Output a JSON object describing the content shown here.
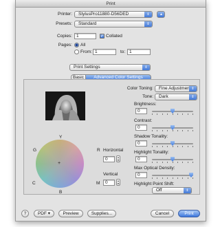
{
  "window": {
    "title": "Print"
  },
  "printer": {
    "label": "Printer:",
    "value": "StylusPro11880-D56DED"
  },
  "presets": {
    "label": "Presets:",
    "value": "Standard"
  },
  "copies": {
    "label": "Copies:",
    "value": "1",
    "collated_label": "Collated"
  },
  "pages": {
    "label": "Pages:",
    "all_label": "All",
    "from_label": "From:",
    "from_value": "1",
    "to_label": "to:",
    "to_value": "1"
  },
  "section": {
    "value": "Print Settings"
  },
  "tabs": [
    {
      "label": "Basic"
    },
    {
      "label": "Advanced Color Settings"
    }
  ],
  "color_toning": {
    "label": "Color Toning:",
    "value": "Fine Adjustment"
  },
  "tone": {
    "label": "Tone:",
    "value": "Dark"
  },
  "brightness": {
    "label": "Brightness:",
    "value": "0",
    "level": 0.5
  },
  "contrast": {
    "label": "Contrast:",
    "value": "0",
    "level": 0.5
  },
  "shadow_tonality": {
    "label": "Shadow Tonality:",
    "value": "0",
    "level": 0.5
  },
  "highlight_tonality": {
    "label": "Highlight Tonality:",
    "value": "0",
    "level": 0.5
  },
  "max_optical_density": {
    "label": "Max Optical Density:",
    "value": "0",
    "level": 1.0
  },
  "highlight_point_shift": {
    "label": "Highlight Point Shift:",
    "value": "Off"
  },
  "color_circle": {
    "y": "Y",
    "r": "R",
    "g": "G",
    "m": "M",
    "c": "C",
    "b": "B"
  },
  "horizontal": {
    "label": "Horizontal",
    "value": "0"
  },
  "vertical": {
    "label": "Vertical",
    "value": "0"
  },
  "footer": {
    "help": "?",
    "pdf": "PDF ▾",
    "preview": "Preview",
    "supplies": "Supplies...",
    "cancel": "Cancel",
    "print": "Print"
  }
}
